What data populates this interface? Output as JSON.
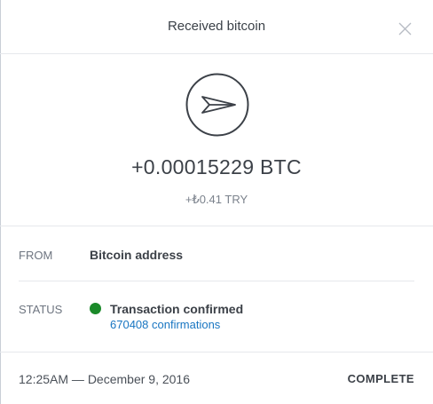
{
  "header": {
    "title": "Received bitcoin",
    "close_icon": "close-icon"
  },
  "summary": {
    "icon": "paper-plane-icon",
    "amount": "+0.00015229 BTC",
    "fiat_amount": "+₺0.41 TRY"
  },
  "details": {
    "from": {
      "label": "FROM",
      "value": "Bitcoin address"
    },
    "status": {
      "label": "STATUS",
      "value": "Transaction confirmed",
      "confirmations": "670408 confirmations",
      "dot_color": "#1b8a2a"
    }
  },
  "footer": {
    "date": "12:25AM — December 9, 2016",
    "state": "COMPLETE"
  },
  "colors": {
    "text": "#3c4148",
    "muted": "#6e7580",
    "link": "#1976c2",
    "confirmed": "#1b8a2a"
  }
}
